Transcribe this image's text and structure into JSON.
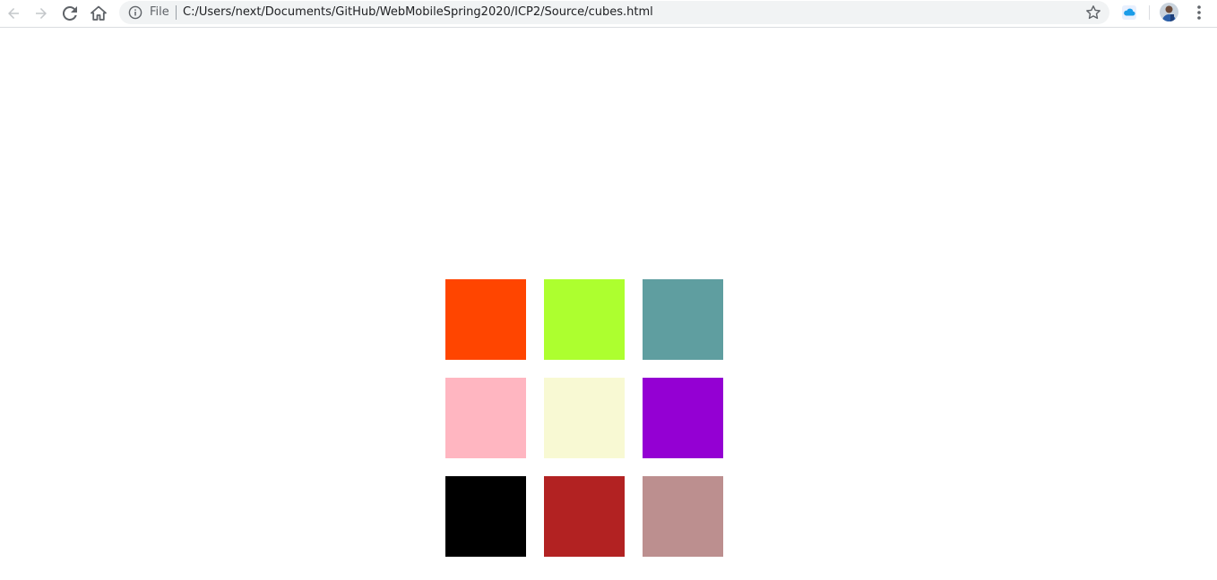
{
  "browser": {
    "scheme_label": "File",
    "url": "C:/Users/next/Documents/GitHub/WebMobileSpring2020/ICP2/Source/cubes.html",
    "icons": {
      "back": "back-arrow-icon",
      "forward": "forward-arrow-icon",
      "reload": "reload-icon",
      "home": "home-icon",
      "info": "info-icon",
      "bookmark": "star-icon",
      "extension": "cloud-extension-icon",
      "profile": "avatar",
      "menu": "kebab-menu-icon"
    }
  },
  "cubes": [
    {
      "color": "#FF4500"
    },
    {
      "color": "#ADFF2F"
    },
    {
      "color": "#5F9EA0"
    },
    {
      "color": "#FFB6C1"
    },
    {
      "color": "#F8F9D3"
    },
    {
      "color": "#9400D3"
    },
    {
      "color": "#000000"
    },
    {
      "color": "#B22222"
    },
    {
      "color": "#BC8F8F"
    }
  ]
}
